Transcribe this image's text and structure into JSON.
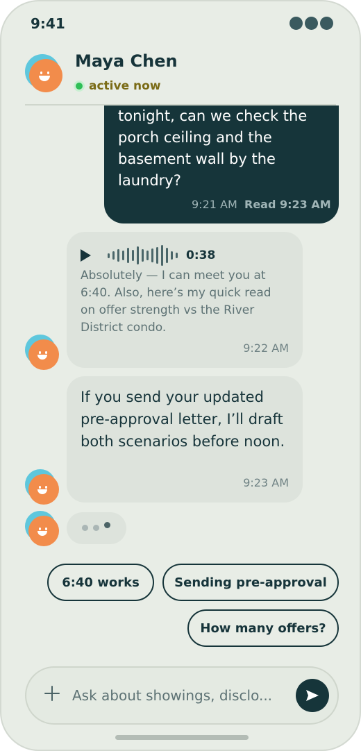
{
  "status_bar": {
    "time": "9:41"
  },
  "header": {
    "contact_name": "Maya Chen",
    "presence": "active now",
    "presence_color": "#2fbf57"
  },
  "messages": {
    "outgoing": {
      "text": "tonight, can we check the porch ceiling and the basement wall by the laundry?",
      "time": "9:21 AM",
      "read_receipt": "Read 9:23 AM"
    },
    "voice_note": {
      "duration": "0:38",
      "caption": "Absolutely — I can meet you at 6:40. Also, here’s my quick read on offer strength vs the River District condo.",
      "time": "9:22 AM"
    },
    "incoming_text": {
      "text": "If you send your updated pre-approval letter, I’ll draft both scenarios before noon.",
      "time": "9:23 AM"
    }
  },
  "quick_replies": [
    "6:40 works",
    "Sending pre-approval",
    "How many offers?"
  ],
  "composer": {
    "placeholder": "Ask about showings, disclo...",
    "value": ""
  },
  "colors": {
    "background": "#e8ede6",
    "outgoing_bubble": "#16353a",
    "incoming_bubble": "#dde3dc",
    "accent_text": "#7a6b16"
  },
  "icons": [
    "play-icon",
    "waveform-icon",
    "plus-icon",
    "send-icon",
    "typing-indicator-icon",
    "avatar"
  ]
}
